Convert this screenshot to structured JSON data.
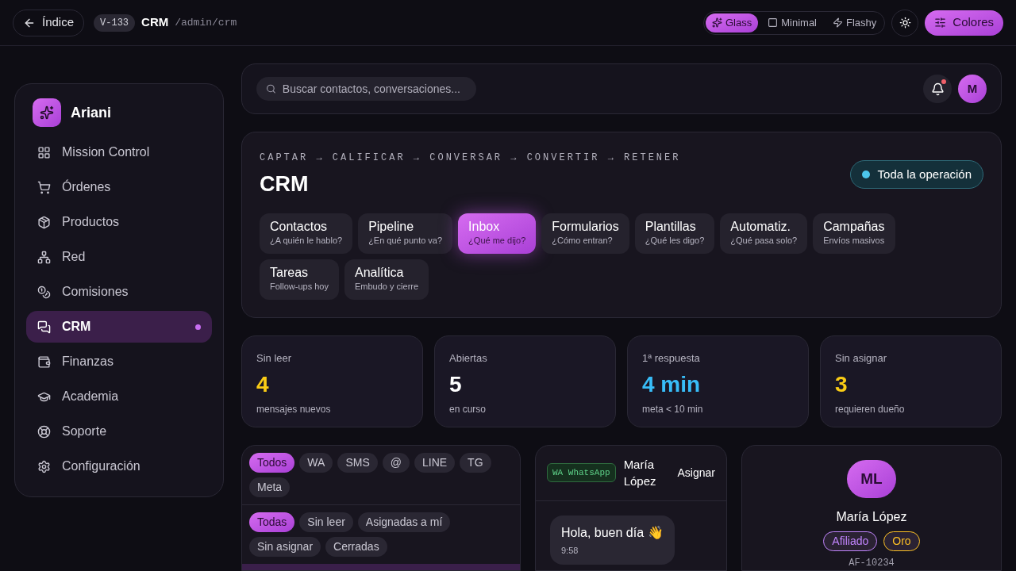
{
  "topbar": {
    "back": "Índice",
    "version": "V-133",
    "title": "CRM",
    "path": "/admin/crm",
    "styles": [
      {
        "label": "Glass",
        "selected": true
      },
      {
        "label": "Minimal",
        "selected": false
      },
      {
        "label": "Flashy",
        "selected": false
      }
    ],
    "colors_button": "Colores"
  },
  "sidebar": {
    "brand": "Ariani",
    "items": [
      {
        "label": "Mission Control",
        "selected": false
      },
      {
        "label": "Órdenes",
        "selected": false
      },
      {
        "label": "Productos",
        "selected": false
      },
      {
        "label": "Red",
        "selected": false
      },
      {
        "label": "Comisiones",
        "selected": false
      },
      {
        "label": "CRM",
        "selected": true
      },
      {
        "label": "Finanzas",
        "selected": false
      },
      {
        "label": "Academia",
        "selected": false
      },
      {
        "label": "Soporte",
        "selected": false
      },
      {
        "label": "Configuración",
        "selected": false
      }
    ]
  },
  "header": {
    "search": {
      "placeholder": "Buscar contactos, conversaciones..."
    },
    "notification": true,
    "avatar": "M"
  },
  "hero": {
    "flow": "CAPTAR → CALIFICAR → CONVERSAR → CONVERTIR → RETENER",
    "title": "CRM",
    "scope": "Toda la operación",
    "tabs": [
      {
        "label": "Contactos",
        "hint": "¿A quién le hablo?",
        "selected": false
      },
      {
        "label": "Pipeline",
        "hint": "¿En qué punto va?",
        "selected": false
      },
      {
        "label": "Inbox",
        "hint": "¿Qué me dijo?",
        "selected": true
      },
      {
        "label": "Formularios",
        "hint": "¿Cómo entran?",
        "selected": false
      },
      {
        "label": "Plantillas",
        "hint": "¿Qué les digo?",
        "selected": false
      },
      {
        "label": "Automatiz.",
        "hint": "¿Qué pasa solo?",
        "selected": false
      },
      {
        "label": "Campañas",
        "hint": "Envíos masivos",
        "selected": false
      },
      {
        "label": "Tareas",
        "hint": "Follow-ups hoy",
        "selected": false
      },
      {
        "label": "Analítica",
        "hint": "Embudo y cierre",
        "selected": false
      }
    ]
  },
  "stats": [
    {
      "label": "Sin leer",
      "value": "4",
      "note": "mensajes nuevos",
      "color": "#facc15"
    },
    {
      "label": "Abiertas",
      "value": "5",
      "note": "en curso",
      "color": "#ffffff"
    },
    {
      "label": "1ª respuesta",
      "value": "4 min",
      "note": "meta < 10 min",
      "color": "#38bdf8"
    },
    {
      "label": "Sin asignar",
      "value": "3",
      "note": "requieren dueño",
      "color": "#facc15"
    }
  ],
  "inbox": {
    "channels": [
      {
        "label": "Todos",
        "selected": true
      },
      {
        "label": "WA",
        "selected": false
      },
      {
        "label": "SMS",
        "selected": false
      },
      {
        "label": "@",
        "selected": false
      },
      {
        "label": "LINE",
        "selected": false
      },
      {
        "label": "TG",
        "selected": false
      },
      {
        "label": "Meta",
        "selected": false
      }
    ],
    "filters": [
      {
        "label": "Todas",
        "selected": true
      },
      {
        "label": "Sin leer",
        "selected": false
      },
      {
        "label": "Asignadas a mí",
        "selected": false
      },
      {
        "label": "Sin asignar",
        "selected": false
      },
      {
        "label": "Cerradas",
        "selected": false
      }
    ]
  },
  "chat": {
    "channel": "WA WhatsApp",
    "name": "María López",
    "assign": "Asignar",
    "messages": [
      {
        "text": "Hola, buen día 👋",
        "time": "9:58"
      }
    ]
  },
  "contact": {
    "initials": "ML",
    "name": "María López",
    "id": "AF-10234",
    "tags": [
      {
        "label": "Afiliado",
        "color": "#c084fc"
      },
      {
        "label": "Oro",
        "color": "#fbbf24"
      }
    ]
  }
}
